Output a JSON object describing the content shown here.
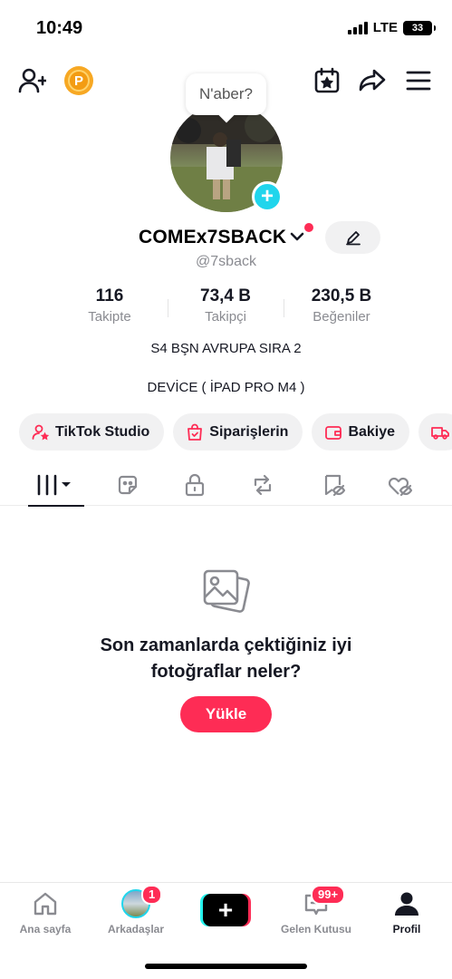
{
  "status_bar": {
    "time": "10:49",
    "network": "LTE",
    "battery": "33"
  },
  "tooltip": {
    "text": "N'aber?"
  },
  "profile": {
    "username": "COMEx7SBACK",
    "handle": "@7sback",
    "stats": [
      {
        "value": "116",
        "label": "Takipte"
      },
      {
        "value": "73,4 B",
        "label": "Takipçi"
      },
      {
        "value": "230,5 B",
        "label": "Beğeniler"
      }
    ],
    "bio": [
      "S4 BŞN AVRUPA SIRA 2",
      "DEVİCE ( İPAD PRO M4 )"
    ]
  },
  "chips": [
    {
      "label": "TikTok Studio",
      "icon": "person-star-icon"
    },
    {
      "label": "Siparişlerin",
      "icon": "shopping-bag-icon"
    },
    {
      "label": "Bakiye",
      "icon": "wallet-icon"
    },
    {
      "label": "",
      "icon": "truck-icon"
    }
  ],
  "tabs": [
    {
      "icon": "grid-icon",
      "active": true
    },
    {
      "icon": "sticker-icon"
    },
    {
      "icon": "lock-icon"
    },
    {
      "icon": "repost-icon"
    },
    {
      "icon": "bookmark-eye-icon"
    },
    {
      "icon": "liked-icon"
    }
  ],
  "empty_state": {
    "title_line1": "Son zamanlarda çektiğiniz iyi",
    "title_line2": "fotoğraflar neler?",
    "button": "Yükle"
  },
  "bottom_nav": [
    {
      "label": "Ana sayfa",
      "icon": "home-icon"
    },
    {
      "label": "Arkadaşlar",
      "icon": "friends-avatar",
      "badge": "1"
    },
    {
      "label": "",
      "icon": "create-icon"
    },
    {
      "label": "Gelen Kutusu",
      "icon": "inbox-icon",
      "badge": "99+"
    },
    {
      "label": "Profil",
      "icon": "profile-icon",
      "active": true
    }
  ],
  "colors": {
    "accent": "#fe2c55",
    "cyan": "#20d5ec",
    "coin": "#f7a823"
  }
}
